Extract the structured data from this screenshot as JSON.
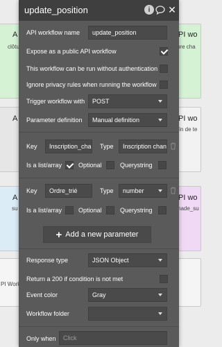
{
  "background": {
    "left_cards": [
      {
        "title": "A",
        "subtitle": "clôtu"
      },
      {
        "title": "A",
        "subtitle": ""
      },
      {
        "title": "A",
        "subtitle": "su"
      },
      {
        "title": "",
        "subtitle": "PI Work"
      }
    ],
    "right_cards": [
      {
        "title": "PI wo",
        "subtitle": "ure cha"
      },
      {
        "title": "PI wo",
        "subtitle": "fin de te"
      },
      {
        "title": "PI wo",
        "subtitle": "nade_su"
      },
      {
        "title": "",
        "subtitle": ""
      }
    ]
  },
  "panel": {
    "title": "update_position",
    "workflow_name_label": "API workflow name",
    "workflow_name_value": "update_position",
    "expose_label": "Expose as a public API workflow",
    "expose_checked": true,
    "no_auth_label": "This workflow can be run without authentication",
    "no_auth_checked": false,
    "ignore_privacy_label": "Ignore privacy rules when running the workflow",
    "ignore_privacy_checked": false,
    "trigger_label": "Trigger workflow with",
    "trigger_value": "POST",
    "param_def_label": "Parameter definition",
    "param_def_value": "Manual definition",
    "params": [
      {
        "key_label": "Key",
        "key_value": "Inscription_chan",
        "type_label": "Type",
        "type_value": "Inscription chan",
        "list_label": "Is a list/array",
        "list_checked": true,
        "optional_label": "Optional",
        "optional_checked": false,
        "querystring_label": "Querystring",
        "querystring_checked": false
      },
      {
        "key_label": "Key",
        "key_value": "Ordre_trié",
        "type_label": "Type",
        "type_value": "number",
        "list_label": "Is a list/array",
        "list_checked": false,
        "optional_label": "Optional",
        "optional_checked": false,
        "querystring_label": "Querystring",
        "querystring_checked": false
      }
    ],
    "add_param_label": "Add a new parameter",
    "response_type_label": "Response type",
    "response_type_value": "JSON Object",
    "return200_label": "Return a 200 if condition is not met",
    "return200_checked": false,
    "event_color_label": "Event color",
    "event_color_value": "Gray",
    "folder_label": "Workflow folder",
    "folder_value": "",
    "only_when_label": "Only when",
    "only_when_placeholder": "Click"
  },
  "colors": {
    "panel_bg": "#5a5a5a",
    "panel_header": "#3f3f3f",
    "field_bg": "#4a4a4a",
    "green_card": "#d5f2d5",
    "purple_card": "#f0d9f5",
    "blue_card": "#dcecf7"
  },
  "icons": {
    "info": "info-icon",
    "comment": "comment-icon",
    "close": "close-icon",
    "trash": "trash-icon",
    "plus": "plus-icon",
    "dropdown": "chevron-down-icon"
  }
}
